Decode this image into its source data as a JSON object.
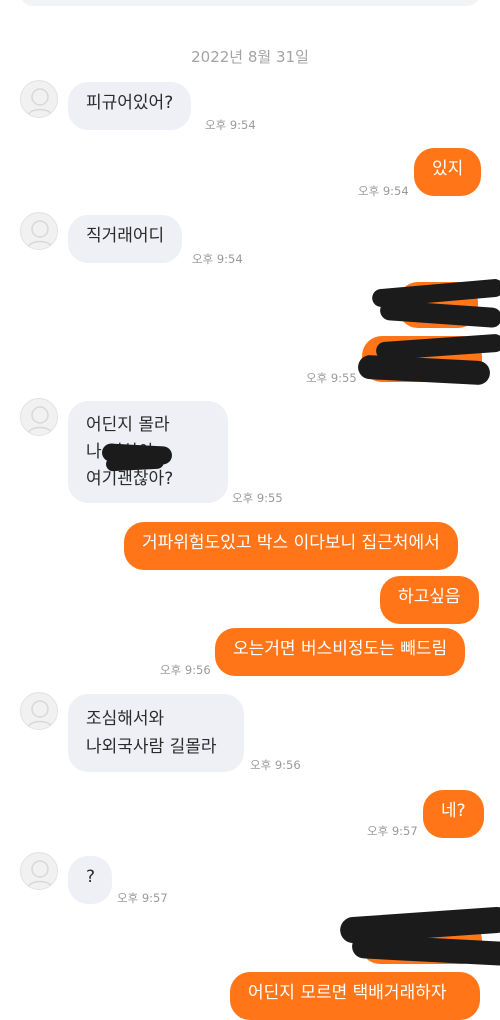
{
  "date_separator": "2022년 8월 31일",
  "messages": [
    {
      "side": "in",
      "text": "피규어있어?",
      "time": "오후 9:54"
    },
    {
      "side": "out",
      "text": "있지",
      "time": "오후 9:54"
    },
    {
      "side": "in",
      "text": "직거래어디",
      "time": "오후 9:54"
    },
    {
      "side": "out",
      "text": "",
      "time": "오후 9:55",
      "redacted": true
    },
    {
      "side": "in",
      "line1": "어딘지 몰라",
      "line2": "나 역살아",
      "line3": "여기괜찮아?",
      "time": "오후 9:55",
      "redacted": true
    },
    {
      "side": "out",
      "text": "거파위험도있고 박스 이다보니 집근처에서"
    },
    {
      "side": "out",
      "text": "하고싶음"
    },
    {
      "side": "out",
      "text": "오는거면 버스비정도는 빼드림",
      "time": "오후 9:56"
    },
    {
      "side": "in",
      "line1": "조심해서와",
      "line2": "나외국사람 길몰라",
      "time": "오후 9:56"
    },
    {
      "side": "out",
      "text": "네?",
      "time": "오후 9:57"
    },
    {
      "side": "in",
      "text": "?",
      "time": "오후 9:57"
    },
    {
      "side": "out",
      "text": "어딘지 모르면 택배거래하자",
      "redacted": true
    }
  ],
  "colors": {
    "outgoing": "#ff7518",
    "incoming": "#eef0f5",
    "redaction": "#1b1b1b"
  },
  "icons": {
    "avatar": "default-profile-icon"
  }
}
